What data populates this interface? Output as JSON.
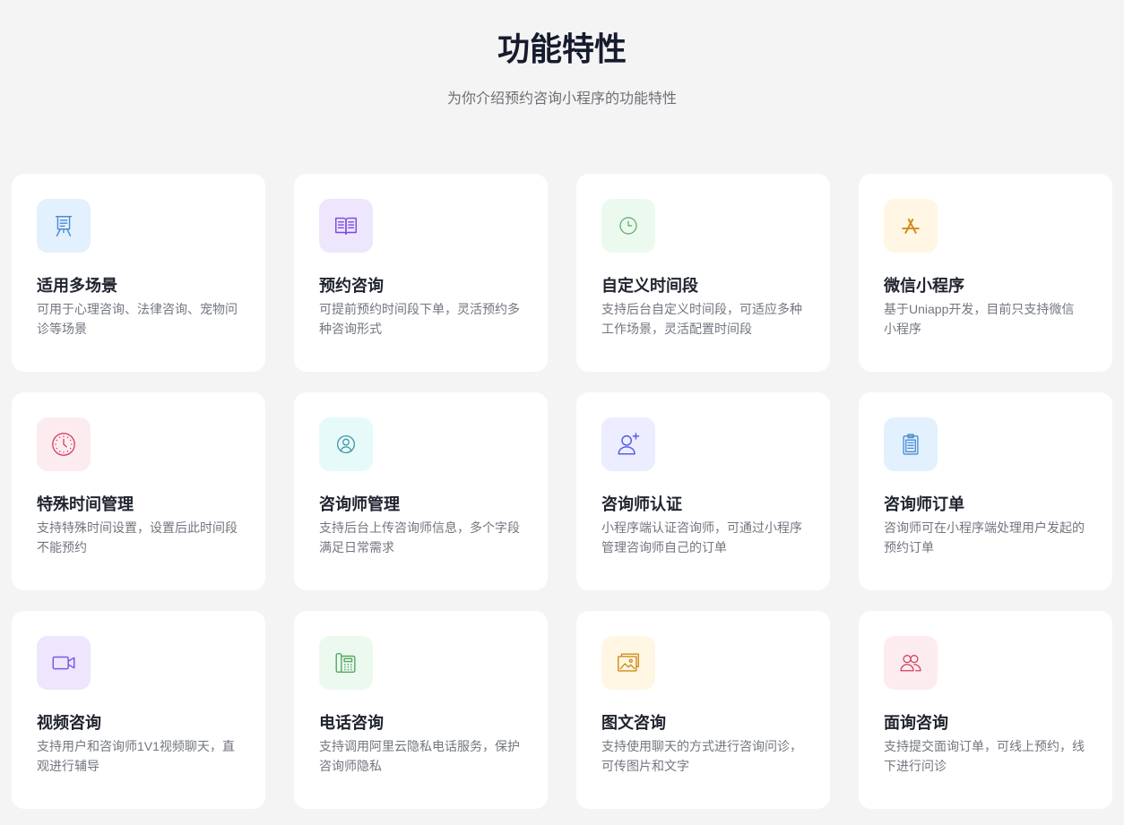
{
  "header": {
    "title": "功能特性",
    "subtitle": "为你介绍预约咨询小程序的功能特性"
  },
  "features": [
    {
      "title": "适用多场景",
      "description": "可用于心理咨询、法律咨询、宠物问诊等场景",
      "icon": "easel-board-icon",
      "color": "#4a8bd3",
      "bg": "#e3f0fd"
    },
    {
      "title": "预约咨询",
      "description": "可提前预约时间段下单，灵活预约多种咨询形式",
      "icon": "open-book-icon",
      "color": "#7b45e4",
      "bg": "#ede6fd"
    },
    {
      "title": "自定义时间段",
      "description": "支持后台自定义时间段，可适应多种工作场景，灵活配置时间段",
      "icon": "clock-icon",
      "color": "#53a862",
      "bg": "#ecf9ef"
    },
    {
      "title": "微信小程序",
      "description": "基于Uniapp开发，目前只支持微信小程序",
      "icon": "app-store-icon",
      "color": "#d18a1d",
      "bg": "#fff7e3"
    },
    {
      "title": "特殊时间管理",
      "description": "支持特殊时间设置，设置后此时间段不能预约",
      "icon": "timer-clock-icon",
      "color": "#d2405f",
      "bg": "#fdecef"
    },
    {
      "title": "咨询师管理",
      "description": "支持后台上传咨询师信息，多个字段满足日常需求",
      "icon": "user-circle-icon",
      "color": "#3e96a6",
      "bg": "#e6fafa"
    },
    {
      "title": "咨询师认证",
      "description": "小程序端认证咨询师，可通过小程序管理咨询师自己的订单",
      "icon": "user-plus-icon",
      "color": "#5b5fe2",
      "bg": "#ecedfe"
    },
    {
      "title": "咨询师订单",
      "description": "咨询师可在小程序端处理用户发起的预约订单",
      "icon": "clipboard-icon",
      "color": "#4a8bd3",
      "bg": "#e3f0fd"
    },
    {
      "title": "视频咨询",
      "description": "支持用户和咨询师1V1视频聊天，直观进行辅导",
      "icon": "video-camera-icon",
      "color": "#7b5ae4",
      "bg": "#ede6fd"
    },
    {
      "title": "电话咨询",
      "description": "支持调用阿里云隐私电话服务，保护咨询师隐私",
      "icon": "desk-phone-icon",
      "color": "#53a862",
      "bg": "#ecf9ef"
    },
    {
      "title": "图文咨询",
      "description": "支持使用聊天的方式进行咨询问诊，可传图片和文字",
      "icon": "image-gallery-icon",
      "color": "#d18a1d",
      "bg": "#fff7e3"
    },
    {
      "title": "面询咨询",
      "description": "支持提交面询订单，可线上预约，线下进行问诊",
      "icon": "users-icon",
      "color": "#d2405f",
      "bg": "#fdecef"
    }
  ]
}
